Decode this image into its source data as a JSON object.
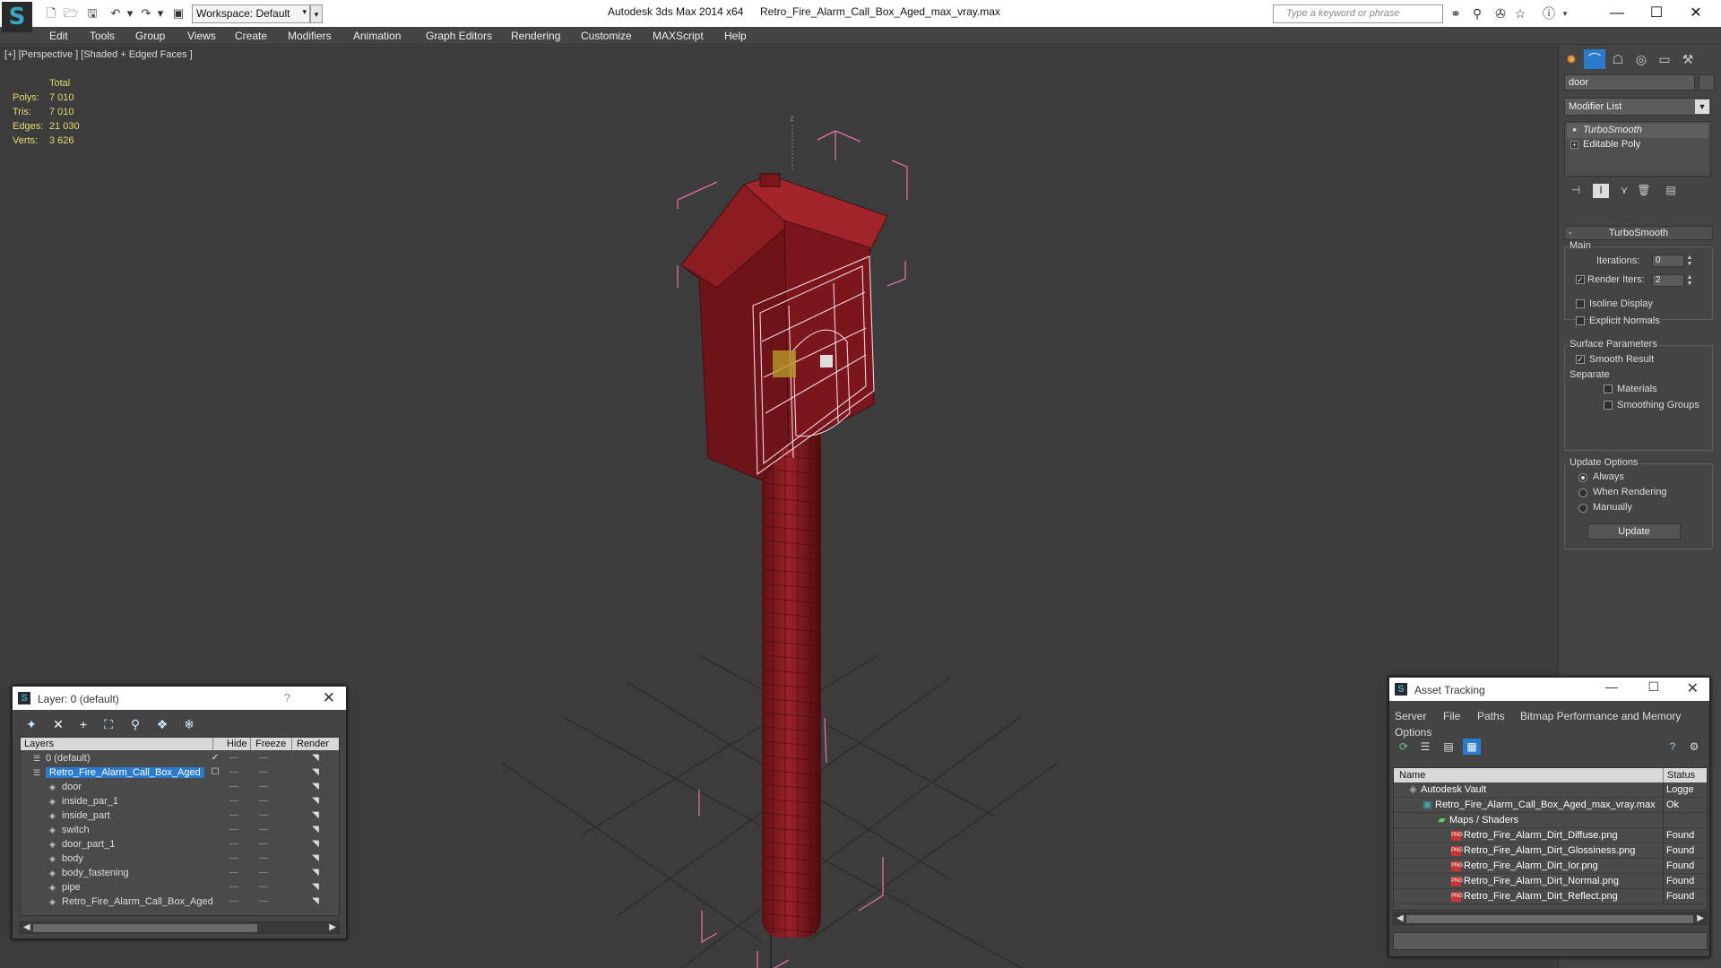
{
  "titlebar": {
    "workspace": "Workspace: Default",
    "app_title": "Autodesk 3ds Max  2014 x64",
    "file_title": "Retro_Fire_Alarm_Call_Box_Aged_max_vray.max",
    "search_placeholder": "Type a keyword or phrase",
    "minimize": "—",
    "maximize": "☐",
    "close": "✕"
  },
  "menu": [
    "Edit",
    "Tools",
    "Group",
    "Views",
    "Create",
    "Modifiers",
    "Animation",
    "Graph Editors",
    "Rendering",
    "Customize",
    "MAXScript",
    "Help"
  ],
  "viewport": {
    "label": "[+] [Perspective ] [Shaded + Edged Faces ]",
    "stats": {
      "header": "Total",
      "rows": [
        {
          "k": "Polys:",
          "v": "7 010"
        },
        {
          "k": "Tris:",
          "v": "7 010"
        },
        {
          "k": "Edges:",
          "v": "21 030"
        },
        {
          "k": "Verts:",
          "v": "3 626"
        }
      ]
    },
    "axis_label": "z",
    "model_color": "#8b1c22",
    "wire_color": "#e070a0"
  },
  "command_panel": {
    "object_name": "door",
    "modifier_list": "Modifier List",
    "stack": [
      "TurboSmooth",
      "Editable Poly"
    ],
    "rollout_title": "TurboSmooth",
    "main": {
      "title": "Main",
      "iterations_label": "Iterations:",
      "iterations_value": "0",
      "render_iters_label": "Render Iters:",
      "render_iters_value": "2",
      "isoline": "Isoline Display",
      "explicit_normals": "Explicit Normals"
    },
    "surface": {
      "title": "Surface Parameters",
      "smooth_result": "Smooth Result",
      "separate": "Separate",
      "materials": "Materials",
      "smoothing_groups": "Smoothing Groups"
    },
    "update": {
      "title": "Update Options",
      "always": "Always",
      "when_rendering": "When Rendering",
      "manually": "Manually",
      "button": "Update"
    }
  },
  "layer_dialog": {
    "title": "Layer: 0 (default)",
    "help": "?",
    "close": "✕",
    "columns": {
      "layers": "Layers",
      "hide": "Hide",
      "freeze": "Freeze",
      "render": "Render"
    },
    "rows": [
      {
        "name": "0 (default)",
        "level": 0
      },
      {
        "name": "Retro_Fire_Alarm_Call_Box_Aged",
        "level": 0,
        "selected": true
      },
      {
        "name": "door",
        "level": 1
      },
      {
        "name": "inside_par_1",
        "level": 1
      },
      {
        "name": "inside_part",
        "level": 1
      },
      {
        "name": "switch",
        "level": 1
      },
      {
        "name": "door_part_1",
        "level": 1
      },
      {
        "name": "body",
        "level": 1
      },
      {
        "name": "body_fastening",
        "level": 1
      },
      {
        "name": "pipe",
        "level": 1
      },
      {
        "name": "Retro_Fire_Alarm_Call_Box_Aged",
        "level": 1
      }
    ]
  },
  "asset_dialog": {
    "title": "Asset Tracking",
    "menu": [
      "Server",
      "File",
      "Paths",
      "Bitmap Performance and Memory",
      "Options"
    ],
    "columns": {
      "name": "Name",
      "status": "Status"
    },
    "rows": [
      {
        "name": "Autodesk Vault",
        "status": "Logge",
        "level": 0,
        "icon": "vault"
      },
      {
        "name": "Retro_Fire_Alarm_Call_Box_Aged_max_vray.max",
        "status": "Ok",
        "level": 1,
        "icon": "max"
      },
      {
        "name": "Maps / Shaders",
        "status": "",
        "level": 2,
        "icon": "maps"
      },
      {
        "name": "Retro_Fire_Alarm_Dirt_Diffuse.png",
        "status": "Found",
        "level": 3,
        "icon": "png"
      },
      {
        "name": "Retro_Fire_Alarm_Dirt_Glossiness.png",
        "status": "Found",
        "level": 3,
        "icon": "png"
      },
      {
        "name": "Retro_Fire_Alarm_Dirt_Ior.png",
        "status": "Found",
        "level": 3,
        "icon": "png"
      },
      {
        "name": "Retro_Fire_Alarm_Dirt_Normal.png",
        "status": "Found",
        "level": 3,
        "icon": "png"
      },
      {
        "name": "Retro_Fire_Alarm_Dirt_Reflect.png",
        "status": "Found",
        "level": 3,
        "icon": "png"
      }
    ]
  }
}
